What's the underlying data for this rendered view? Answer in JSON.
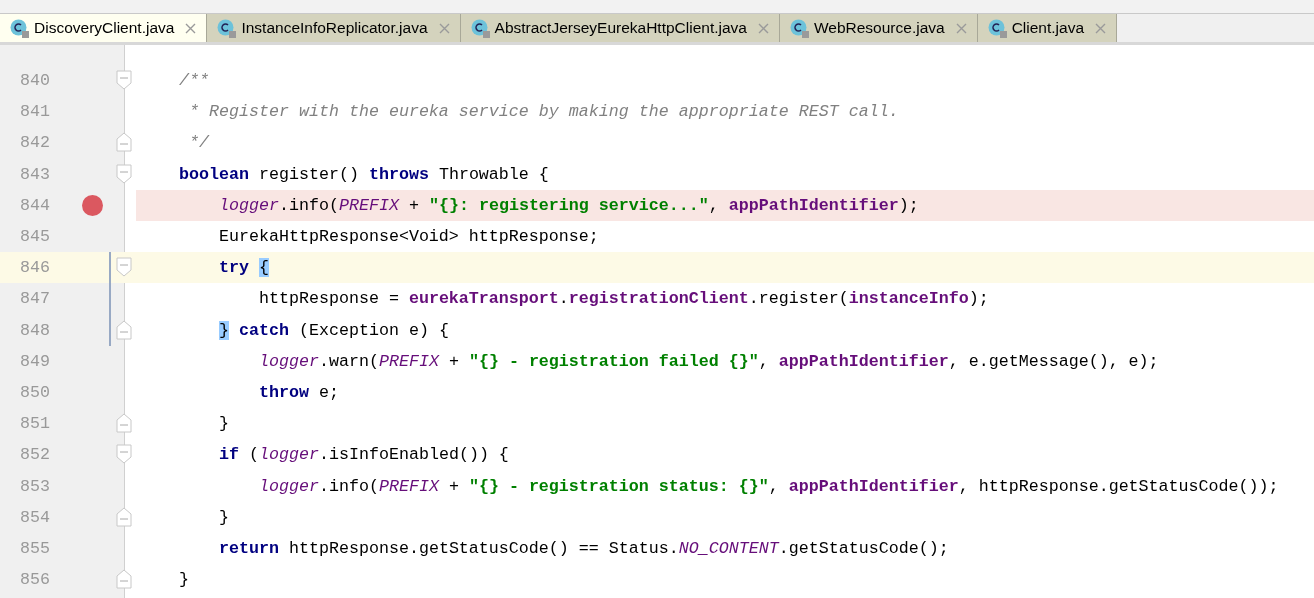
{
  "tabs": [
    {
      "label": "DiscoveryClient.java",
      "selected": true
    },
    {
      "label": "InstanceInfoReplicator.java",
      "selected": false
    },
    {
      "label": "AbstractJerseyEurekaHttpClient.java",
      "selected": false
    },
    {
      "label": "WebResource.java",
      "selected": false
    },
    {
      "label": "Client.java",
      "selected": false
    }
  ],
  "editor": {
    "lines": [
      {
        "number": "840",
        "fold_start": true,
        "fold_end": false,
        "breakpoint": false,
        "current": false,
        "changed": false,
        "tokens": [
          {
            "kind": "comment",
            "text": "    /**"
          }
        ]
      },
      {
        "number": "841",
        "fold_start": false,
        "fold_end": false,
        "breakpoint": false,
        "current": false,
        "changed": false,
        "tokens": [
          {
            "kind": "comment",
            "text": "     * Register with the eureka service by making the appropriate REST call."
          }
        ]
      },
      {
        "number": "842",
        "fold_start": false,
        "fold_end": true,
        "breakpoint": false,
        "current": false,
        "changed": false,
        "tokens": [
          {
            "kind": "comment",
            "text": "     */"
          }
        ]
      },
      {
        "number": "843",
        "fold_start": true,
        "fold_end": false,
        "breakpoint": false,
        "current": false,
        "changed": false,
        "tokens": [
          {
            "kind": "keyword",
            "text": "    boolean"
          },
          {
            "kind": "plain",
            "text": " register() "
          },
          {
            "kind": "keyword",
            "text": "throws"
          },
          {
            "kind": "plain",
            "text": " Throwable {"
          }
        ]
      },
      {
        "number": "844",
        "fold_start": false,
        "fold_end": false,
        "breakpoint": true,
        "current": false,
        "changed": false,
        "tokens": [
          {
            "kind": "static",
            "text": "        logger"
          },
          {
            "kind": "plain",
            "text": ".info("
          },
          {
            "kind": "static",
            "text": "PREFIX"
          },
          {
            "kind": "plain",
            "text": " + "
          },
          {
            "kind": "string",
            "text": "\"{}: registering service...\""
          },
          {
            "kind": "plain",
            "text": ", "
          },
          {
            "kind": "field",
            "text": "appPathIdentifier"
          },
          {
            "kind": "plain",
            "text": ");"
          }
        ]
      },
      {
        "number": "845",
        "fold_start": false,
        "fold_end": false,
        "breakpoint": false,
        "current": false,
        "changed": false,
        "tokens": [
          {
            "kind": "plain",
            "text": "        EurekaHttpResponse<Void> httpResponse;"
          }
        ]
      },
      {
        "number": "846",
        "fold_start": true,
        "fold_end": false,
        "breakpoint": false,
        "current": true,
        "changed": true,
        "tokens": [
          {
            "kind": "keyword",
            "text": "        try"
          },
          {
            "kind": "brace",
            "text": " {"
          }
        ]
      },
      {
        "number": "847",
        "fold_start": false,
        "fold_end": false,
        "breakpoint": false,
        "current": false,
        "changed": true,
        "tokens": [
          {
            "kind": "plain",
            "text": "            httpResponse = "
          },
          {
            "kind": "field",
            "text": "eurekaTransport"
          },
          {
            "kind": "plain",
            "text": "."
          },
          {
            "kind": "field",
            "text": "registrationClient"
          },
          {
            "kind": "plain",
            "text": ".register("
          },
          {
            "kind": "field",
            "text": "instanceInfo"
          },
          {
            "kind": "plain",
            "text": ");"
          }
        ]
      },
      {
        "number": "848",
        "fold_start": false,
        "fold_end": true,
        "breakpoint": false,
        "current": false,
        "changed": true,
        "tokens": [
          {
            "kind": "brace",
            "text": "        }"
          },
          {
            "kind": "keyword",
            "text": " catch"
          },
          {
            "kind": "plain",
            "text": " (Exception e) {"
          }
        ]
      },
      {
        "number": "849",
        "fold_start": false,
        "fold_end": false,
        "breakpoint": false,
        "current": false,
        "changed": false,
        "tokens": [
          {
            "kind": "static",
            "text": "            logger"
          },
          {
            "kind": "plain",
            "text": ".warn("
          },
          {
            "kind": "static",
            "text": "PREFIX"
          },
          {
            "kind": "plain",
            "text": " + "
          },
          {
            "kind": "string",
            "text": "\"{} - registration failed {}\""
          },
          {
            "kind": "plain",
            "text": ", "
          },
          {
            "kind": "field",
            "text": "appPathIdentifier"
          },
          {
            "kind": "plain",
            "text": ", e.getMessage(), e);"
          }
        ]
      },
      {
        "number": "850",
        "fold_start": false,
        "fold_end": false,
        "breakpoint": false,
        "current": false,
        "changed": false,
        "tokens": [
          {
            "kind": "keyword",
            "text": "            throw"
          },
          {
            "kind": "plain",
            "text": " e;"
          }
        ]
      },
      {
        "number": "851",
        "fold_start": false,
        "fold_end": true,
        "breakpoint": false,
        "current": false,
        "changed": false,
        "tokens": [
          {
            "kind": "plain",
            "text": "        }"
          }
        ]
      },
      {
        "number": "852",
        "fold_start": true,
        "fold_end": false,
        "breakpoint": false,
        "current": false,
        "changed": false,
        "tokens": [
          {
            "kind": "keyword",
            "text": "        if"
          },
          {
            "kind": "plain",
            "text": " ("
          },
          {
            "kind": "static",
            "text": "logger"
          },
          {
            "kind": "plain",
            "text": ".isInfoEnabled()) {"
          }
        ]
      },
      {
        "number": "853",
        "fold_start": false,
        "fold_end": false,
        "breakpoint": false,
        "current": false,
        "changed": false,
        "tokens": [
          {
            "kind": "static",
            "text": "            logger"
          },
          {
            "kind": "plain",
            "text": ".info("
          },
          {
            "kind": "static",
            "text": "PREFIX"
          },
          {
            "kind": "plain",
            "text": " + "
          },
          {
            "kind": "string",
            "text": "\"{} - registration status: {}\""
          },
          {
            "kind": "plain",
            "text": ", "
          },
          {
            "kind": "field",
            "text": "appPathIdentifier"
          },
          {
            "kind": "plain",
            "text": ", httpResponse.getStatusCode());"
          }
        ]
      },
      {
        "number": "854",
        "fold_start": false,
        "fold_end": true,
        "breakpoint": false,
        "current": false,
        "changed": false,
        "tokens": [
          {
            "kind": "plain",
            "text": "        }"
          }
        ]
      },
      {
        "number": "855",
        "fold_start": false,
        "fold_end": false,
        "breakpoint": false,
        "current": false,
        "changed": false,
        "tokens": [
          {
            "kind": "keyword",
            "text": "        return"
          },
          {
            "kind": "plain",
            "text": " httpResponse.getStatusCode() == Status."
          },
          {
            "kind": "static",
            "text": "NO_CONTENT"
          },
          {
            "kind": "plain",
            "text": ".getStatusCode();"
          }
        ]
      },
      {
        "number": "856",
        "fold_start": false,
        "fold_end": true,
        "breakpoint": false,
        "current": false,
        "changed": false,
        "tokens": [
          {
            "kind": "plain",
            "text": "    }"
          }
        ]
      }
    ]
  }
}
